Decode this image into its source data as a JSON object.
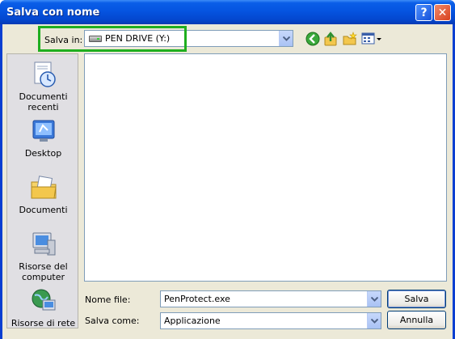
{
  "window": {
    "title": "Salva con nome",
    "help_glyph": "?",
    "close_glyph": "✕"
  },
  "toolbar": {
    "save_in_label": "Salva in:",
    "save_in_value": "PEN DRIVE (Y:)",
    "save_in_icon": "usb-drive-icon",
    "buttons": [
      "back-icon",
      "up-folder-icon",
      "new-folder-icon",
      "view-menu-icon"
    ]
  },
  "places": [
    {
      "label_line1": "Documenti",
      "label_line2": "recenti",
      "icon": "recent-documents-icon"
    },
    {
      "label_line1": "Desktop",
      "label_line2": "",
      "icon": "desktop-icon"
    },
    {
      "label_line1": "Documenti",
      "label_line2": "",
      "icon": "my-documents-icon"
    },
    {
      "label_line1": "Risorse del",
      "label_line2": "computer",
      "icon": "my-computer-icon"
    },
    {
      "label_line1": "Risorse di rete",
      "label_line2": "",
      "icon": "network-places-icon"
    }
  ],
  "form": {
    "filename_label": "Nome file:",
    "filename_value": "PenProtect.exe",
    "savetype_label": "Salva come:",
    "savetype_value": "Applicazione",
    "save_button": "Salva",
    "cancel_button": "Annulla"
  },
  "colors": {
    "titlebar": "#0554e0",
    "dialog_bg": "#ece9d8",
    "highlight": "#1fae1f"
  }
}
